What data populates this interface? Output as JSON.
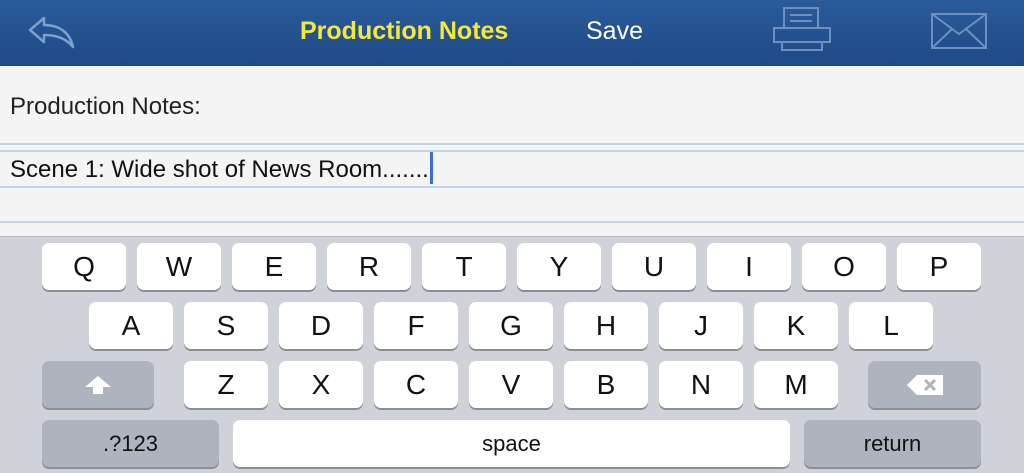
{
  "navbar": {
    "title": "Production Notes",
    "save_label": "Save",
    "icons": [
      "back-arrow-icon",
      "printer-icon",
      "mail-icon"
    ],
    "colors": {
      "bar": "#1e4a86",
      "title": "#f6e83a"
    }
  },
  "document": {
    "heading": "Production Notes:",
    "line1": "Scene 1: Wide shot of News Room......."
  },
  "keyboard": {
    "row1": [
      "Q",
      "W",
      "E",
      "R",
      "T",
      "Y",
      "U",
      "I",
      "O",
      "P"
    ],
    "row2": [
      "A",
      "S",
      "D",
      "F",
      "G",
      "H",
      "J",
      "K",
      "L"
    ],
    "row3": [
      "Z",
      "X",
      "C",
      "V",
      "B",
      "N",
      "M"
    ],
    "numbers_label": ".?123",
    "space_label": "space",
    "return_label": "return",
    "icons": [
      "shift-icon",
      "backspace-icon"
    ]
  }
}
